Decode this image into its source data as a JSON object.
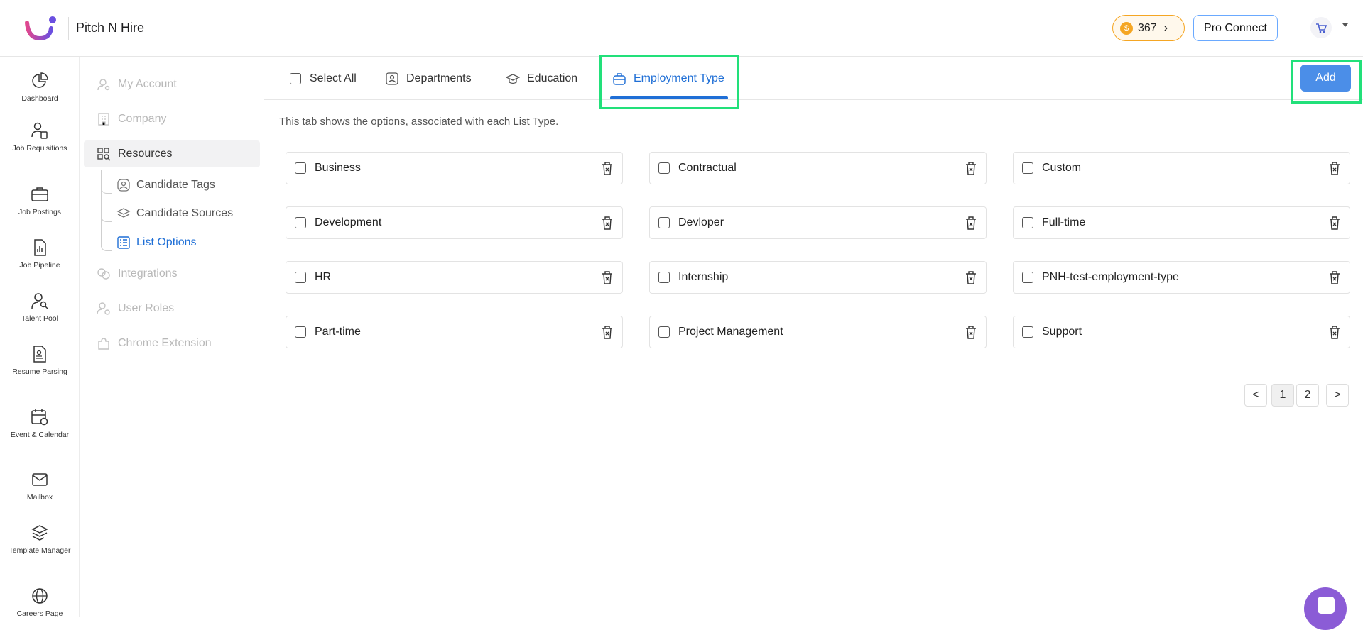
{
  "header": {
    "app_name": "Pitch N Hire",
    "coins": "367",
    "pro_connect_label": "Pro Connect"
  },
  "leftnav": {
    "items": [
      {
        "label": "Dashboard",
        "icon": "dashboard-icon"
      },
      {
        "label": "Job Requisitions",
        "icon": "job-requisitions-icon"
      },
      {
        "label": "Job Postings",
        "icon": "briefcase-icon"
      },
      {
        "label": "Job Pipeline",
        "icon": "pipeline-icon"
      },
      {
        "label": "Talent Pool",
        "icon": "talent-pool-icon"
      },
      {
        "label": "Resume Parsing",
        "icon": "resume-icon"
      },
      {
        "label": "Event & Calendar",
        "icon": "calendar-icon"
      },
      {
        "label": "Mailbox",
        "icon": "mail-icon"
      },
      {
        "label": "Template Manager",
        "icon": "template-icon"
      },
      {
        "label": "Careers Page",
        "icon": "globe-icon"
      }
    ]
  },
  "subnav": {
    "my_account": "My Account",
    "company": "Company",
    "resources": "Resources",
    "candidate_tags": "Candidate Tags",
    "candidate_sources": "Candidate Sources",
    "list_options": "List Options",
    "integrations": "Integrations",
    "user_roles": "User Roles",
    "chrome_extension": "Chrome Extension"
  },
  "tabs": {
    "select_all": "Select All",
    "departments": "Departments",
    "education": "Education",
    "employment_type": "Employment Type"
  },
  "add_label": "Add",
  "description": "This tab shows the options, associated with each List Type.",
  "options": [
    "Business",
    "Contractual",
    "Custom",
    "Development",
    "Devloper",
    "Full-time",
    "HR",
    "Internship",
    "PNH-test-employment-type",
    "Part-time",
    "Project Management",
    "Support"
  ],
  "pagination": {
    "prev": "<",
    "pages": [
      "1",
      "2"
    ],
    "next": ">",
    "current": "1"
  },
  "colors": {
    "accent": "#1f6fd6",
    "add_button": "#4b8ee8",
    "highlight": "#22e07a",
    "coin": "#f5a623",
    "chat": "#8b5cd6"
  }
}
